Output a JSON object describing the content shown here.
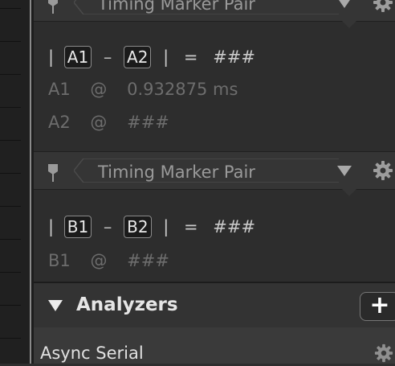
{
  "marker_a": {
    "title": "Timing Marker Pair",
    "start": "A1",
    "end": "A2",
    "open": "|",
    "dash": "–",
    "close": "|",
    "eq": "=",
    "result": "###",
    "line1_label": "A1",
    "line1_at": "@",
    "line1_value": "0.932875 ms",
    "line2_label": "A2",
    "line2_at": "@",
    "line2_value": "###"
  },
  "marker_b": {
    "title": "Timing Marker Pair",
    "start": "B1",
    "end": "B2",
    "open": "|",
    "dash": "–",
    "close": "|",
    "eq": "=",
    "result": "###",
    "line1_label": "B1",
    "line1_at": "@",
    "line1_value": "###"
  },
  "analyzers": {
    "title": "Analyzers",
    "add_label": "+",
    "items": [
      {
        "label": "Async Serial"
      }
    ]
  },
  "colors": {
    "panel_bg": "#2e2e2e",
    "header_bg": "#353535",
    "text": "#cfcfcf",
    "dim_text": "#6d6d6d"
  },
  "icons": [
    "pin-icon",
    "tag-icon",
    "dropdown-triangle-icon",
    "gear-icon",
    "expand-triangle-icon",
    "plus-icon"
  ]
}
